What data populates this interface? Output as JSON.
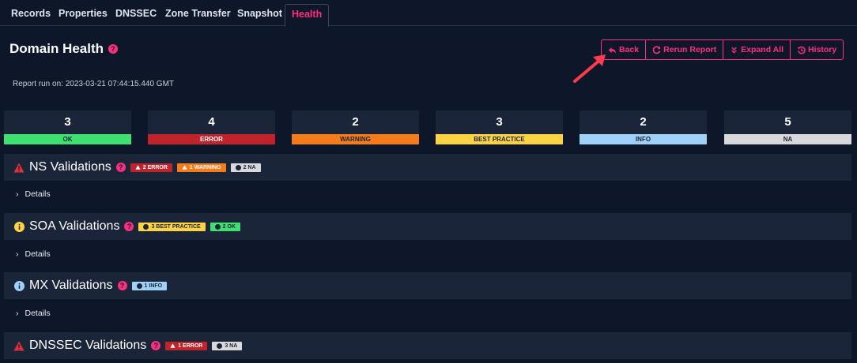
{
  "tabs": [
    {
      "label": "Records"
    },
    {
      "label": "Properties"
    },
    {
      "label": "DNSSEC"
    },
    {
      "label": "Zone Transfer"
    },
    {
      "label": "Snapshot"
    },
    {
      "label": "Health",
      "active": true
    }
  ],
  "header": {
    "title": "Domain Health",
    "report_run": "Report run on: 2023-03-21 07:44:15.440 GMT"
  },
  "toolbar": {
    "back_label": "Back",
    "rerun_label": "Rerun Report",
    "expand_label": "Expand All",
    "history_label": "History"
  },
  "summary": [
    {
      "count": "3",
      "label": "OK",
      "color": "#3fe06f",
      "text_color": "#1b2539"
    },
    {
      "count": "4",
      "label": "ERROR",
      "color": "#c0232a",
      "text_color": "#ffffff"
    },
    {
      "count": "2",
      "label": "WARNING",
      "color": "#f57c18",
      "text_color": "#1b2539"
    },
    {
      "count": "3",
      "label": "BEST PRACTICE",
      "color": "#ffd342",
      "text_color": "#1b2539"
    },
    {
      "count": "2",
      "label": "INFO",
      "color": "#9fd0f7",
      "text_color": "#1b2539"
    },
    {
      "count": "5",
      "label": "NA",
      "color": "#d9d9d9",
      "text_color": "#1b2539"
    }
  ],
  "sections": [
    {
      "title": "NS Validations",
      "icon": "warning-triangle-icon",
      "badges": [
        {
          "label": "2 ERROR",
          "type": "error"
        },
        {
          "label": "1 WARNING",
          "type": "warning"
        },
        {
          "label": "2 NA",
          "type": "na"
        }
      ],
      "details_label": "Details"
    },
    {
      "title": "SOA Validations",
      "icon": "info-circle-yellow-icon",
      "badges": [
        {
          "label": "3 BEST PRACTICE",
          "type": "best"
        },
        {
          "label": "2 OK",
          "type": "ok"
        }
      ],
      "details_label": "Details"
    },
    {
      "title": "MX Validations",
      "icon": "info-circle-blue-icon",
      "badges": [
        {
          "label": "1 INFO",
          "type": "info"
        }
      ],
      "details_label": "Details"
    },
    {
      "title": "DNSSEC Validations",
      "icon": "warning-triangle-icon",
      "badges": [
        {
          "label": "1 ERROR",
          "type": "error"
        },
        {
          "label": "3 NA",
          "type": "na"
        }
      ]
    }
  ],
  "colors": {
    "accent": "#ff2e7e",
    "background": "#0e1729",
    "panel": "#1b2539"
  }
}
